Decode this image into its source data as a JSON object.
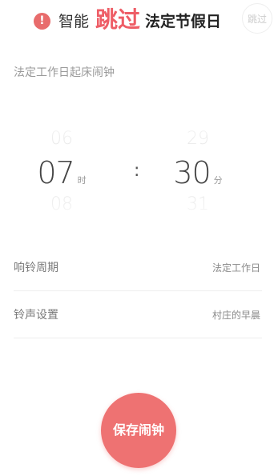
{
  "banner": {
    "alert_symbol": "!",
    "text_prefix": "智能",
    "text_highlight": "跳过",
    "text_suffix": "法定节假日",
    "skip_label": "跳过",
    "highlight_color": "#ee5d66"
  },
  "section": {
    "title": "法定工作日起床闹钟"
  },
  "time_picker": {
    "hour_prev": "06",
    "hour_current": "07",
    "hour_next": "08",
    "hour_unit": "时",
    "separator": ":",
    "minute_prev": "29",
    "minute_current": "30",
    "minute_next": "31",
    "minute_unit": "分"
  },
  "settings": {
    "cycle": {
      "label": "响铃周期",
      "value": "法定工作日"
    },
    "sound": {
      "label": "铃声设置",
      "value": "村庄的早晨"
    }
  },
  "save_button": {
    "label": "保存闹钟",
    "color": "#ee7272"
  },
  "icons": {
    "alert": "exclamation-circle-icon"
  }
}
